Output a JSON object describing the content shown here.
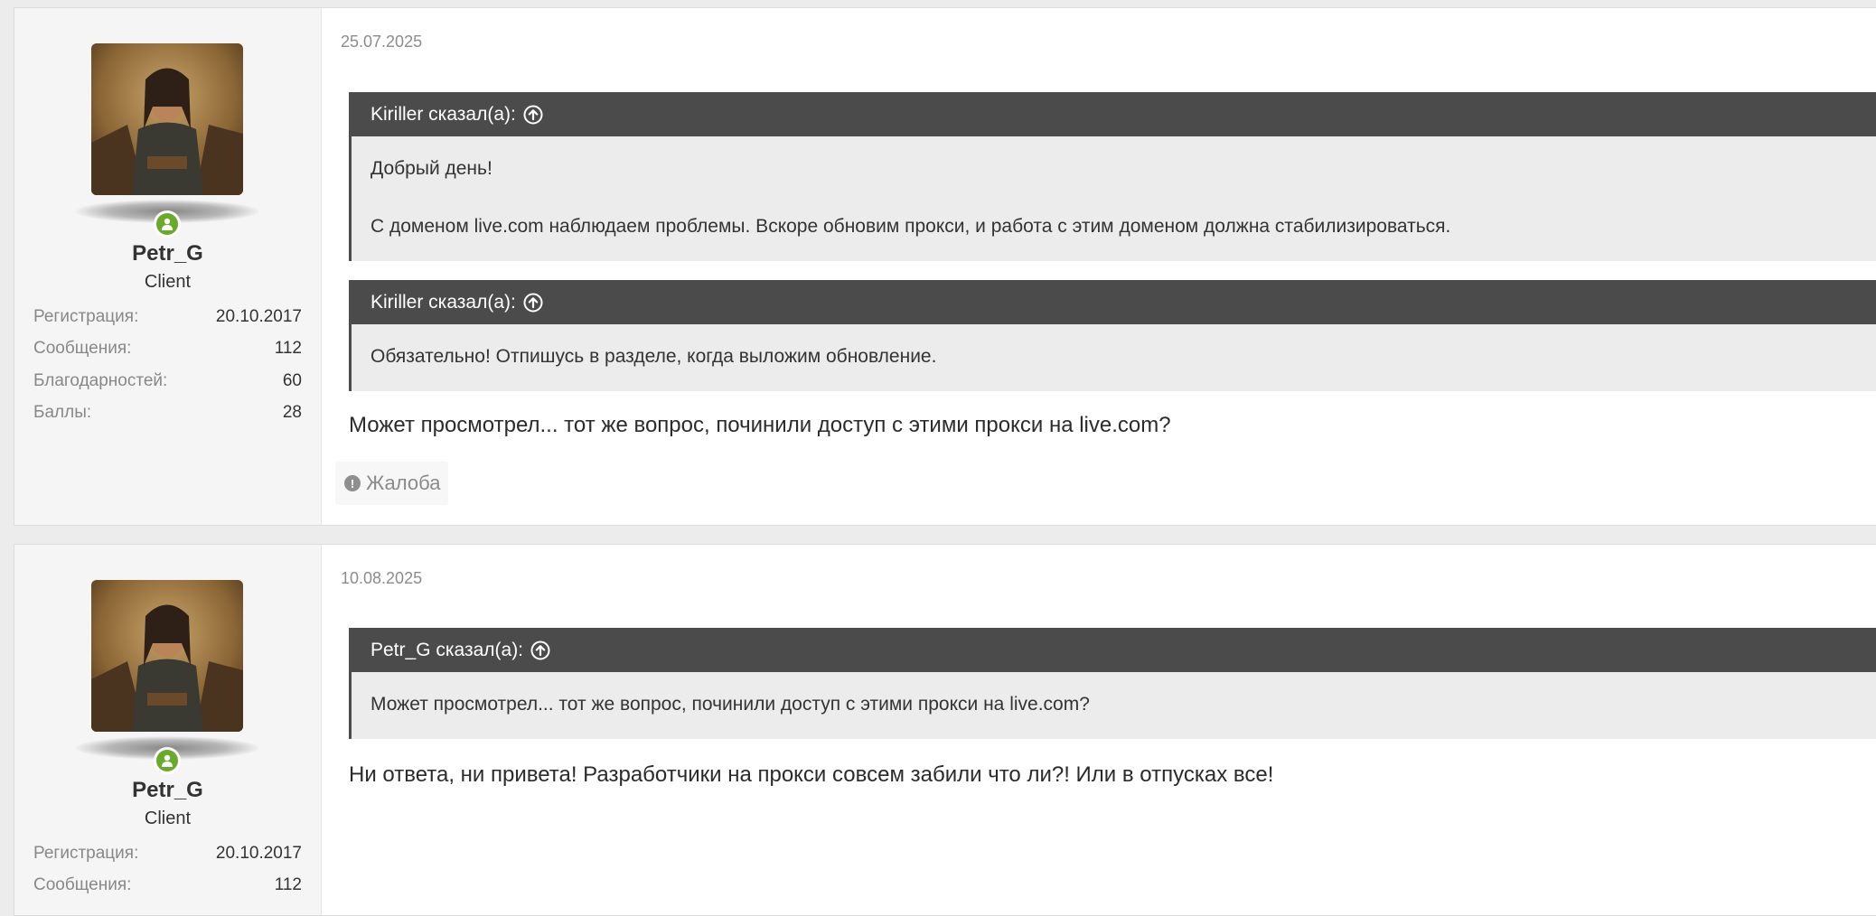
{
  "posts": [
    {
      "author": {
        "name": "Petr_G",
        "title": "Client",
        "stats": [
          {
            "label": "Регистрация:",
            "value": "20.10.2017"
          },
          {
            "label": "Сообщения:",
            "value": "112"
          },
          {
            "label": "Благодарностей:",
            "value": "60"
          },
          {
            "label": "Баллы:",
            "value": "28"
          }
        ]
      },
      "date": "25.07.2025",
      "quotes": [
        {
          "header": "Kiriller сказал(а):",
          "lines": [
            "Добрый день!",
            "С доменом live.com наблюдаем проблемы. Вскоре обновим прокси, и работа с этим доменом должна стабилизироваться."
          ]
        },
        {
          "header": "Kiriller сказал(а):",
          "lines": [
            "Обязательно! Отпишусь в разделе, когда выложим обновление."
          ]
        }
      ],
      "message": "Может просмотрел... тот же вопрос, починили доступ с этими прокси на live.com?",
      "report_label": "Жалоба"
    },
    {
      "author": {
        "name": "Petr_G",
        "title": "Client",
        "stats": [
          {
            "label": "Регистрация:",
            "value": "20.10.2017"
          },
          {
            "label": "Сообщения:",
            "value": "112"
          }
        ]
      },
      "date": "10.08.2025",
      "quotes": [
        {
          "header": "Petr_G сказал(а):",
          "lines": [
            "Может просмотрел... тот же вопрос, починили доступ с этими прокси на live.com?"
          ]
        }
      ],
      "message": "Ни ответа, ни привета! Разработчики на прокси совсем забили что ли?! Или в отпусках все!"
    }
  ],
  "colors": {
    "quote_header_bg": "#4b4b4b",
    "quote_body_bg": "#ececec",
    "online_status": "#6aaa2a"
  },
  "icons": {
    "quote_jump": "arrow-circle-up-icon",
    "online": "user-online-icon",
    "report": "exclamation-circle-icon"
  }
}
